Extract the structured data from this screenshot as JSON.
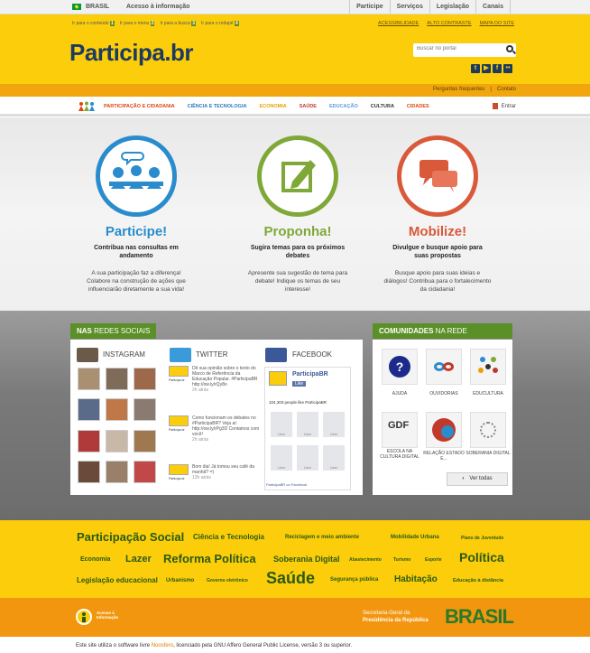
{
  "gov_bar": {
    "country": "BRASIL",
    "access": "Acesso à informação",
    "links": [
      "Participe",
      "Serviços",
      "Legislação",
      "Canais"
    ]
  },
  "accessibility": {
    "skip_links": [
      {
        "label": "Ir para o conteúdo",
        "key": "1"
      },
      {
        "label": "Ir para o menu",
        "key": "2"
      },
      {
        "label": "Ir para a busca",
        "key": "3"
      },
      {
        "label": "Ir para o rodapé",
        "key": "4"
      }
    ],
    "right_links": [
      "ACESSIBILIDADE",
      "ALTO CONTRASTE",
      "MAPA DO SITE"
    ]
  },
  "header": {
    "logo": "Participa.br",
    "search_placeholder": "Buscar no portal",
    "social_icons": [
      "twitter-icon",
      "youtube-icon",
      "facebook-icon",
      "flickr-icon"
    ]
  },
  "subbar": {
    "faq": "Perguntas frequentes",
    "separator": "|",
    "contact": "Contato"
  },
  "nav": {
    "items": [
      {
        "label": "PARTICIPAÇÃO E CIDADANIA",
        "color": "#d9480f"
      },
      {
        "label": "CIÊNCIA E TECNOLOGIA",
        "color": "#2a7ab8"
      },
      {
        "label": "ECONOMIA",
        "color": "#e8a200"
      },
      {
        "label": "SAÚDE",
        "color": "#c0392b"
      },
      {
        "label": "EDUCAÇÃO",
        "color": "#5b9bd5"
      },
      {
        "label": "CULTURA",
        "color": "#333333"
      },
      {
        "label": "CIDADES",
        "color": "#d9480f"
      }
    ],
    "login": "Entrar"
  },
  "hero": [
    {
      "title": "Participe!",
      "color": "#2a8ccc",
      "subtitle": "Contribua nas consultas em andamento",
      "desc": "A sua participação faz a diferença! Colabore na construção de ações que influenciarão diretamente a sua vida!",
      "icon": "people-discussion-icon"
    },
    {
      "title": "Proponha!",
      "color": "#7fa838",
      "subtitle": "Sugira temas para os próximos debates",
      "desc": "Apresente sua sugestão de tema para debate! Indique os temas de seu interesse!",
      "icon": "edit-icon"
    },
    {
      "title": "Mobilize!",
      "color": "#d9593a",
      "subtitle": "Divulgue e busque apoio para suas propostas",
      "desc": "Busque apoio para suas ideias e diálogos! Contribua para o fortalecimento da cidadania!",
      "icon": "chat-bubbles-icon"
    }
  ],
  "social_panel": {
    "title_bold": "NAS",
    "title_rest": " REDES SOCIAIS",
    "instagram": "INSTAGRAM",
    "twitter": "TWITTER",
    "facebook": "FACEBOOK",
    "tweets": [
      {
        "text": "Dê sua opinião sobre o texto do Marco de Referência da Educação Popular. #ParticipaBR http://ow.ly/rQy8o",
        "time": "2h atrás"
      },
      {
        "text": "Como funcionam os debates no #ParticipaBR? Veja aí: http://ow.ly/rPg3D Contamos com você!",
        "time": "2h atrás"
      },
      {
        "text": "Bom dia! Já tomou seu café da manhã? =)",
        "time": "13h atrás"
      }
    ],
    "avatar_label": "Participa.br",
    "fb": {
      "page": "ParticipaBR",
      "like": "Like",
      "count": "104,303 people like ParticipaBR",
      "user": "User",
      "footer": "ParticipaBR on Facebook"
    }
  },
  "communities_panel": {
    "title_bold": "COMUNIDADES",
    "title_rest": " NA REDE",
    "items": [
      "AJUDA",
      "OUVIDORIAS",
      "EDUCULTURA",
      "ESCOLA NA CULTURA DIGITAL",
      "RELAÇÃO ESTADO E...",
      "SOBERANIA DIGITAL"
    ],
    "see_all": "Ver todas"
  },
  "tags": [
    "Participação Social",
    "Ciência e Tecnologia",
    "Reciclagem e meio ambiente",
    "Mobilidade Urbana",
    "Plano de Juventude",
    "Economia",
    "Lazer",
    "Reforma Política",
    "Soberania Digital",
    "Abastecimento",
    "Turismo",
    "Esporte",
    "Política",
    "Legislação educacional",
    "Urbanismo",
    "Governo eletrônico",
    "Saúde",
    "Segurança pública",
    "Habitação",
    "Educação à distância"
  ],
  "footer": {
    "acesso": "Acesso à Informação",
    "sg_line1": "Secretaria-Geral da",
    "sg_line2": "Presidência da República",
    "brasil": "BRASIL",
    "copy_pre": "Este site utiliza o software livre ",
    "copy_link": "Noosfero",
    "copy_post": ", licenciado pela GNU Affero General Public License, versão 3 ou superior."
  }
}
